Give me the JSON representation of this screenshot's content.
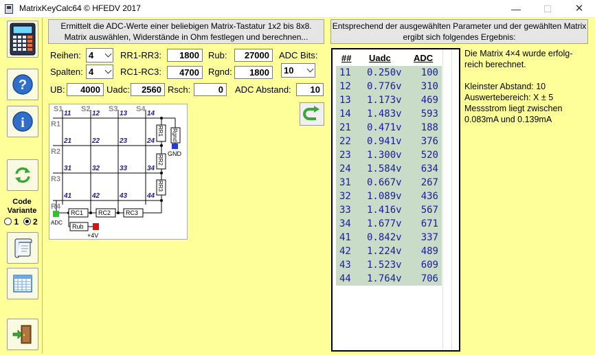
{
  "window": {
    "title": "MatrixKeyCalc64 © HFEDV 2017"
  },
  "sidebar": {
    "code_variant_label": "Code\nVariante",
    "radio_options": [
      {
        "label": "1",
        "checked": false
      },
      {
        "label": "2",
        "checked": true
      }
    ]
  },
  "description": "Ermittelt die ADC-Werte einer beliebigen Matrix-Tastatur 1x2 bis 8x8. Matrix auswählen, Widerstände in Ohm festlegen und berechnen...",
  "result_header": "Entsprechend der ausgewählten Parameter und der gewählten Matrix ergibt sich folgendes Ergebnis:",
  "params": {
    "reihen_label": "Reihen:",
    "reihen": "4",
    "spalten_label": "Spalten:",
    "spalten": "4",
    "rr_label": "RR1-RR3:",
    "rr": "1800",
    "rc_label": "RC1-RC3:",
    "rc": "4700",
    "rub_label": "Rub:",
    "rub": "27000",
    "rgnd_label": "Rgnd:",
    "rgnd": "1800",
    "adcbits_label": "ADC Bits:",
    "adcbits": "10",
    "ub_label": "UB:",
    "ub": "4000",
    "uadc_label": "Uadc:",
    "uadc": "2560",
    "rsch_label": "Rsch:",
    "rsch": "0",
    "adcabstand_label": "ADC Abstand:",
    "adcabstand": "10"
  },
  "schematic": {
    "columns": [
      "S1",
      "S2",
      "S3",
      "S4"
    ],
    "rows": [
      "R1",
      "R2",
      "R3",
      "R4"
    ],
    "keys": [
      "11",
      "12",
      "13",
      "14",
      "21",
      "22",
      "23",
      "24",
      "31",
      "32",
      "33",
      "34",
      "41",
      "42",
      "43",
      "44"
    ],
    "resistors_rr": [
      "RR1",
      "RR2",
      "RR3"
    ],
    "resistors_rc": [
      "RC1",
      "RC2",
      "RC3"
    ],
    "rgnd": "Rgnd",
    "rub": "Rub",
    "gnd": "GND",
    "adc": "ADC",
    "vcc": "+4V"
  },
  "table": {
    "headers": [
      "##",
      "Uadc",
      "ADC"
    ],
    "rows": [
      [
        "11",
        "0.250v",
        "100"
      ],
      [
        "12",
        "0.776v",
        "310"
      ],
      [
        "13",
        "1.173v",
        "469"
      ],
      [
        "14",
        "1.483v",
        "593"
      ],
      [
        "21",
        "0.471v",
        "188"
      ],
      [
        "22",
        "0.941v",
        "376"
      ],
      [
        "23",
        "1.300v",
        "520"
      ],
      [
        "24",
        "1.584v",
        "634"
      ],
      [
        "31",
        "0.667v",
        "267"
      ],
      [
        "32",
        "1.089v",
        "436"
      ],
      [
        "33",
        "1.416v",
        "567"
      ],
      [
        "34",
        "1.677v",
        "671"
      ],
      [
        "41",
        "0.842v",
        "337"
      ],
      [
        "42",
        "1.224v",
        "489"
      ],
      [
        "43",
        "1.523v",
        "609"
      ],
      [
        "44",
        "1.764v",
        "706"
      ]
    ]
  },
  "result_text": "Die Matrix 4×4 wurde erfolg-\nreich berechnet.\n\nKleinster Abstand: 10\nAuswertebereich: X ± 5\nMessstrom liegt zwischen\n0.083mA und 0.139mA",
  "colors": {
    "background": "#ffff99",
    "row_highlight": "#c8dcc8",
    "value_text": "#1a1aa0",
    "gnd_marker": "#1e3cdc",
    "adc_marker": "#22cc22",
    "vcc_marker": "#dd1111"
  }
}
